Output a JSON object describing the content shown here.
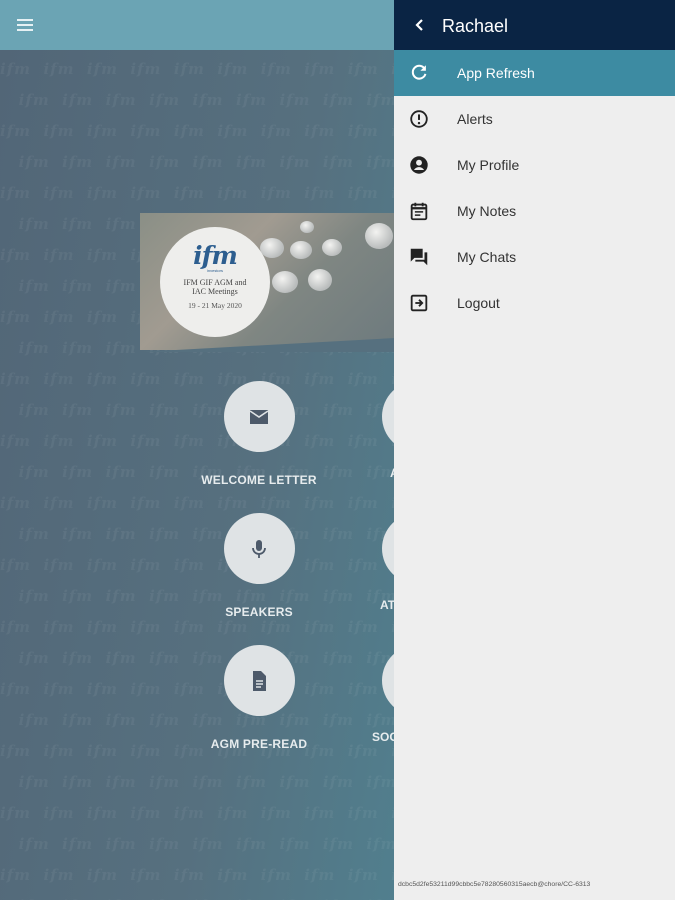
{
  "drawer": {
    "user_name": "Rachael",
    "items": [
      {
        "label": "App Refresh",
        "icon": "refresh-icon",
        "active": true
      },
      {
        "label": "Alerts",
        "icon": "alert-circle-icon",
        "active": false
      },
      {
        "label": "My Profile",
        "icon": "account-circle-icon",
        "active": false
      },
      {
        "label": "My Notes",
        "icon": "notes-icon",
        "active": false
      },
      {
        "label": "My Chats",
        "icon": "chat-icon",
        "active": false
      },
      {
        "label": "Logout",
        "icon": "logout-icon",
        "active": false
      }
    ],
    "build_hash": "dcbc5d2fe53211d99cbbc5e78280560315aecb@chore/CC-6313"
  },
  "event": {
    "logo_text": "ifm",
    "logo_sub": "investors",
    "title": "IFM GIF AGM and IAC Meetings",
    "dates": "19 - 21 May 2020"
  },
  "tiles": [
    {
      "label": "WELCOME LETTER",
      "icon": "mail-icon"
    },
    {
      "label": "SPEAKERS",
      "icon": "microphone-icon"
    },
    {
      "label": "AGM PRE-READ",
      "icon": "document-icon"
    }
  ],
  "partial_tiles": [
    "A",
    "AT",
    "SOC"
  ],
  "colors": {
    "topbar": "#6ba4b4",
    "drawer_header": "#0a2444",
    "active_item": "#3d8ba2",
    "drawer_bg": "#eeeeee"
  }
}
